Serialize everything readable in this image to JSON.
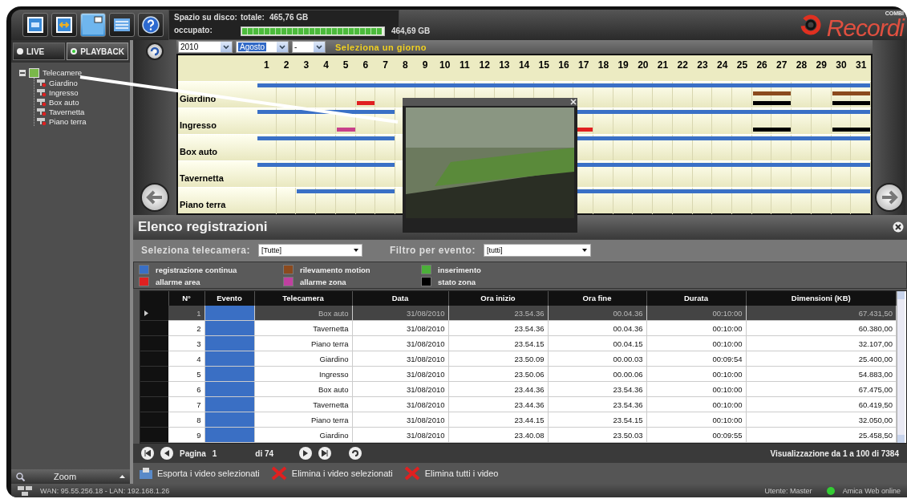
{
  "toolbar": [
    {
      "kind": "camera",
      "selected": false
    },
    {
      "kind": "split",
      "selected": false
    },
    {
      "kind": "view",
      "selected": true
    },
    {
      "kind": "list",
      "selected": false
    },
    {
      "kind": "help",
      "selected": false
    }
  ],
  "disk": {
    "label": "Spazio su disco:",
    "total_label": "totale:",
    "total": "465,76 GB",
    "used_label": "occupato:",
    "level": 0.99,
    "used": "464,69 GB"
  },
  "logo": {
    "brand": "COMBI",
    "name": "Recordi"
  },
  "mode_buttons": [
    {
      "label": "LIVE",
      "selected": false
    },
    {
      "label": "PLAYBACK",
      "selected": true
    }
  ],
  "tree": {
    "label": "Telecamere",
    "expanded": true,
    "children": [
      {
        "label": "Giardino"
      },
      {
        "label": "Ingresso"
      },
      {
        "label": "Box auto"
      },
      {
        "label": "Tavernetta"
      },
      {
        "label": "Piano terra"
      }
    ]
  },
  "zoom": {
    "label": "Zoom"
  },
  "calendar": {
    "year": "2010",
    "month": "Agosto",
    "day": "-",
    "hint": "Seleziona un giorno",
    "days": [
      "1",
      "2",
      "3",
      "4",
      "5",
      "6",
      "7",
      "8",
      "9",
      "10",
      "11",
      "12",
      "13",
      "14",
      "15",
      "16",
      "17",
      "18",
      "19",
      "20",
      "21",
      "22",
      "23",
      "24",
      "25",
      "26",
      "27",
      "28",
      "29",
      "30",
      "31"
    ],
    "cameras": [
      {
        "name": "Giardino"
      },
      {
        "name": "Ingresso"
      },
      {
        "name": "Box auto"
      },
      {
        "name": "Tavernetta"
      },
      {
        "name": "Piano terra"
      }
    ]
  },
  "recordings": {
    "title": "Elenco registrazioni",
    "camera_filter_label": "Seleziona telecamera:",
    "camera_filter": "[Tutte]",
    "event_filter_label": "Filtro per evento:",
    "event_filter": "[tutti]",
    "legend": [
      {
        "label": "registrazione continua",
        "color": "#3a6fc4"
      },
      {
        "label": "rilevamento motion",
        "color": "#8b4a1e"
      },
      {
        "label": "inserimento",
        "color": "#4caf3a"
      },
      {
        "label": "allarme area",
        "color": "#e02020"
      },
      {
        "label": "allarme zona",
        "color": "#c040a0"
      },
      {
        "label": "stato zona",
        "color": "#000000"
      }
    ],
    "columns": [
      "",
      "N°",
      "Evento",
      "Telecamera",
      "Data",
      "Ora inizio",
      "Ora fine",
      "Durata",
      "Dimensioni (KB)"
    ],
    "rows": [
      {
        "selected": true,
        "color": "#3a6fc4",
        "cells": [
          "",
          "1",
          "",
          "Box auto",
          "31/08/2010",
          "23.54.36",
          "00.04.36",
          "00:10:00",
          "67.431,50"
        ]
      },
      {
        "selected": false,
        "color": "#3a6fc4",
        "cells": [
          "",
          "2",
          "",
          "Tavernetta",
          "31/08/2010",
          "23.54.36",
          "00.04.36",
          "00:10:00",
          "60.380,00"
        ]
      },
      {
        "selected": false,
        "color": "#3a6fc4",
        "cells": [
          "",
          "3",
          "",
          "Piano terra",
          "31/08/2010",
          "23.54.15",
          "00.04.15",
          "00:10:00",
          "32.107,00"
        ]
      },
      {
        "selected": false,
        "color": "#3a6fc4",
        "cells": [
          "",
          "4",
          "",
          "Giardino",
          "31/08/2010",
          "23.50.09",
          "00.00.03",
          "00:09:54",
          "25.400,00"
        ]
      },
      {
        "selected": false,
        "color": "#3a6fc4",
        "cells": [
          "",
          "5",
          "",
          "Ingresso",
          "31/08/2010",
          "23.50.06",
          "00.00.06",
          "00:10:00",
          "54.883,00"
        ]
      },
      {
        "selected": false,
        "color": "#3a6fc4",
        "cells": [
          "",
          "6",
          "",
          "Box auto",
          "31/08/2010",
          "23.44.36",
          "23.54.36",
          "00:10:00",
          "67.475,00"
        ]
      },
      {
        "selected": false,
        "color": "#3a6fc4",
        "cells": [
          "",
          "7",
          "",
          "Tavernetta",
          "31/08/2010",
          "23.44.36",
          "23.54.36",
          "00:10:00",
          "60.419,50"
        ]
      },
      {
        "selected": false,
        "color": "#3a6fc4",
        "cells": [
          "",
          "8",
          "",
          "Piano terra",
          "31/08/2010",
          "23.44.15",
          "23.54.15",
          "00:10:00",
          "32.050,00"
        ]
      },
      {
        "selected": false,
        "color": "#3a6fc4",
        "cells": [
          "",
          "9",
          "",
          "Giardino",
          "31/08/2010",
          "23.40.08",
          "23.50.03",
          "00:09:55",
          "25.458,50"
        ]
      }
    ],
    "pager": {
      "page_label": "Pagina",
      "page": "1",
      "total": "di 74",
      "summary": "Visualizzazione da 1 a 100 di 7384"
    }
  },
  "actions": [
    {
      "kind": "export",
      "label": "Esporta i video selezionati"
    },
    {
      "kind": "delete",
      "label": "Elimina i video selezionati"
    },
    {
      "kind": "delete",
      "label": "Elimina tutti i video"
    }
  ],
  "status_bar": {
    "network": "WAN: 95.55.256.18 - LAN: 192.168.1.26",
    "user": "Utente: Master",
    "web": "Amica Web online",
    "online": true
  }
}
